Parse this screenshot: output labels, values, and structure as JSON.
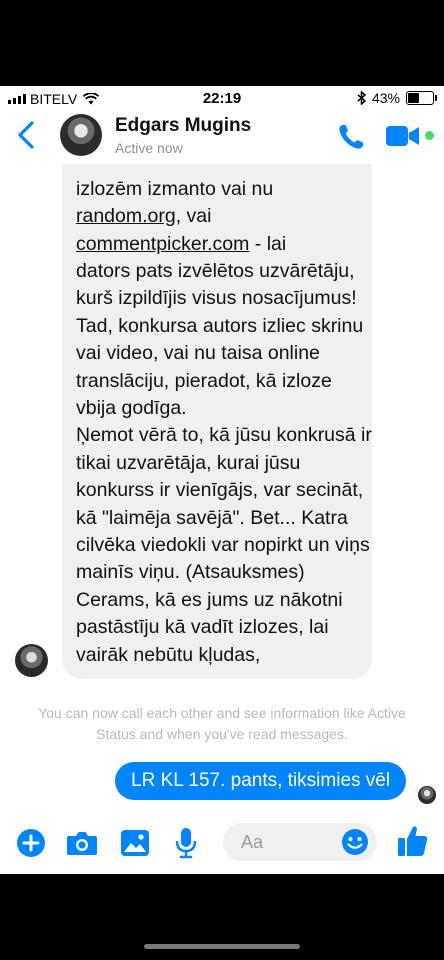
{
  "status_bar": {
    "carrier": "BITELV",
    "time": "22:19",
    "battery": "43%",
    "battery_level": 0.43
  },
  "header": {
    "name": "Edgars Mugins",
    "status": "Active now"
  },
  "message": {
    "line_top": "izlozēm izmanto vai nu",
    "link1": "random.org",
    "after_link1": ", vai",
    "link2": "commentpicker.com",
    "after_link2": " - lai",
    "lines_a": "dators pats izvēlētos uzvārētāju, kurš izpildījis visus nosacījumus! Tad, konkursa autors izliec skrinu vai video, vai nu taisa online translāciju, pieradot, kā izloze vbija godīga.",
    "lines_b": "Ņemot vērā to, kā jūsu konkrusā ir tikai uzvarētāja, kurai jūsu konkurss ir vienīgājs, var secināt, kā \"laimēja savējā\". Bet... Katra cilvēka viedokli var nopirkt un viņs mainīs viņu. (Atsauksmes)",
    "lines_c": "Cerams, kā es jums uz nākotni pastāstīju kā vadīt izlozes, lai vairāk nebūtu kļudas,"
  },
  "system_note": "You can now call each other and see information like Active Status and when you've read messages.",
  "outgoing_message": "LR KL 157. pants, tiksimies vēl",
  "composer": {
    "placeholder": "Aa"
  },
  "colors": {
    "accent": "#0084ff",
    "online": "#4cd964",
    "bubble_gray": "#f1f0f0"
  }
}
